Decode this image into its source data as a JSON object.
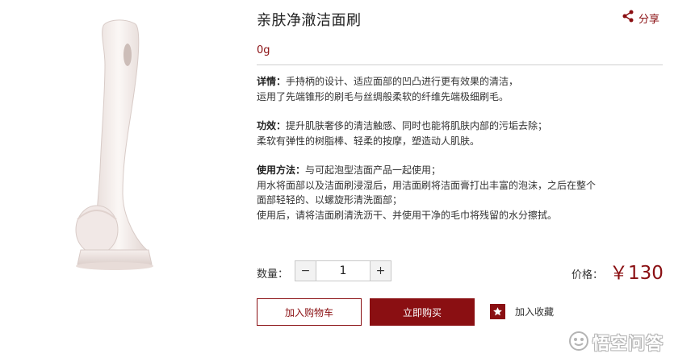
{
  "product": {
    "title": "亲肤净澈洁面刷",
    "weight": "0g",
    "share_label": "分享",
    "image_icon": "facial-brush-image"
  },
  "description": {
    "details": {
      "label": "详情：",
      "lines": [
        "手持柄的设计、适应面部的凹凸进行更有效果的清洁，",
        "运用了先端锥形的刷毛与丝绸般柔软的纤维先端极细刷毛。"
      ]
    },
    "efficacy": {
      "label": "功效：",
      "lines": [
        "提升肌肤奢侈的清洁触感、同时也能将肌肤内部的污垢去除；",
        "柔软有弹性的树脂棒、轻柔的按摩，塑造动人肌肤。"
      ]
    },
    "usage": {
      "label": "使用方法：",
      "lines": [
        "与可起泡型洁面产品一起使用；",
        "用水将面部以及洁面刷浸湿后，用洁面刷将洁面膏打出丰富的泡沫，之后在整个",
        "面部轻轻的、以螺旋形清洗面部；",
        "使用后，请将洁面刷清洗沥干、并使用干净的毛巾将残留的水分擦拭。"
      ]
    }
  },
  "purchase": {
    "quantity_label": "数量：",
    "quantity_value": "1",
    "minus": "−",
    "plus": "+",
    "price_label": "价格：",
    "price": "￥130",
    "add_to_cart": "加入购物车",
    "buy_now": "立即购买",
    "add_favorite": "加入收藏"
  },
  "watermark": {
    "text": "悟空问答"
  },
  "colors": {
    "accent": "#8a0f12",
    "divider": "#cfcfcf"
  }
}
